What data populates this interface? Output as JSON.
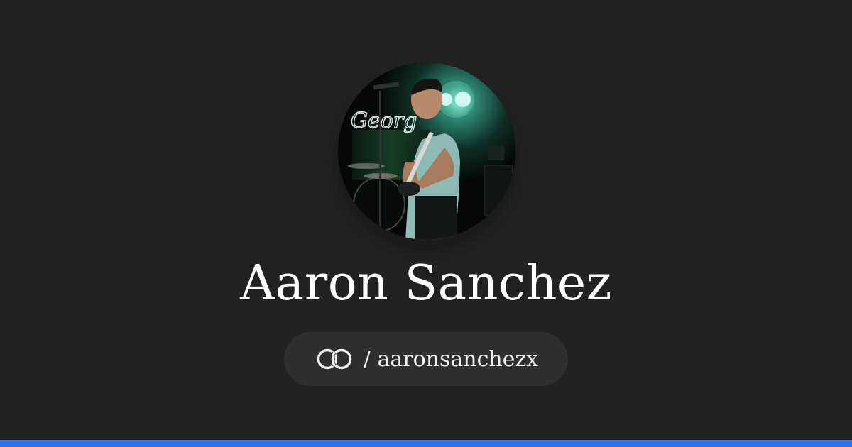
{
  "profile": {
    "name": "Aaron Sanchez",
    "handle": "/ aaronsanchezx",
    "avatar_alt": "profile-photo",
    "avatar_sign_text": "Georg"
  },
  "brand": {
    "logo_icon": "linked-rings-icon",
    "accent_color": "#2f6fe8",
    "background_color": "#222222",
    "pill_color": "#2f2f2f"
  }
}
